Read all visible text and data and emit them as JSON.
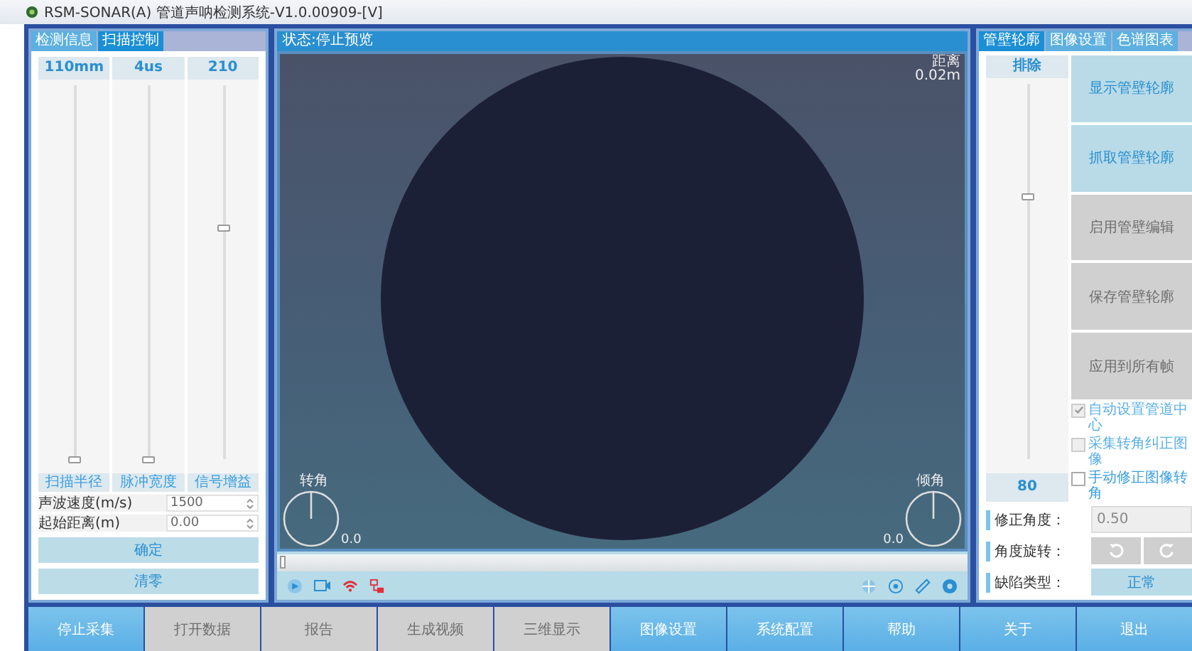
{
  "window": {
    "title": "RSM-SONAR(A) 管道声呐检测系统-V1.0.00909-[V]"
  },
  "left_panel": {
    "tabs": [
      {
        "label": "检测信息",
        "selected": false
      },
      {
        "label": "扫描控制",
        "selected": true
      }
    ],
    "sliders": [
      {
        "value": "110mm",
        "label": "扫描半径",
        "level": 0
      },
      {
        "value": "4us",
        "label": "脉冲宽度",
        "level": 0
      },
      {
        "value": "210",
        "label": "信号增益",
        "level": 0.62
      }
    ],
    "fields": [
      {
        "label": "声波速度(m/s)",
        "value": "1500"
      },
      {
        "label": "起始距离(m)",
        "value": "0.00"
      }
    ],
    "buttons": [
      "确定",
      "清零"
    ]
  },
  "view": {
    "status": "状态:停止预览",
    "distance_label": "距离",
    "distance_value": "0.02m",
    "dials": [
      {
        "label": "转角",
        "reading": "0.0"
      },
      {
        "label": "倾角",
        "reading": "0.0"
      }
    ],
    "scrub": {
      "level": 0
    }
  },
  "right_panel": {
    "tabs": [
      {
        "label": "管壁轮廓",
        "selected": true
      },
      {
        "label": "图像设置",
        "selected": false
      },
      {
        "label": "色谱图表",
        "selected": false
      }
    ],
    "slider": {
      "label": "排除",
      "value": "80",
      "level": 0.7
    },
    "buttons": [
      {
        "label": "显示管壁轮廓",
        "disabled": false
      },
      {
        "label": "抓取管壁轮廓",
        "disabled": false
      },
      {
        "label": "启用管壁编辑",
        "disabled": true
      },
      {
        "label": "保存管壁轮廓",
        "disabled": true
      },
      {
        "label": "应用到所有帧",
        "disabled": true
      }
    ],
    "checkboxes": [
      {
        "label": "自动设置管道中心",
        "checked": true,
        "disabled": true
      },
      {
        "label": "采集转角纠正图像",
        "checked": false,
        "disabled": true
      },
      {
        "label": "手动修正图像转角",
        "checked": false,
        "disabled": false
      }
    ],
    "rows": [
      {
        "kind": "spin",
        "label": "修正角度：",
        "value": "0.50"
      },
      {
        "kind": "rotate",
        "label": "角度旋转："
      },
      {
        "kind": "button",
        "label": "缺陷类型：",
        "value": "正常"
      }
    ]
  },
  "bottom_bar": [
    {
      "label": "停止采集",
      "disabled": false
    },
    {
      "label": "打开数据",
      "disabled": true
    },
    {
      "label": "报告",
      "disabled": true
    },
    {
      "label": "生成视频",
      "disabled": true
    },
    {
      "label": "三维显示",
      "disabled": true
    },
    {
      "label": "图像设置",
      "disabled": false
    },
    {
      "label": "系统配置",
      "disabled": false
    },
    {
      "label": "帮助",
      "disabled": false
    },
    {
      "label": "关于",
      "disabled": false
    },
    {
      "label": "退出",
      "disabled": false
    }
  ]
}
